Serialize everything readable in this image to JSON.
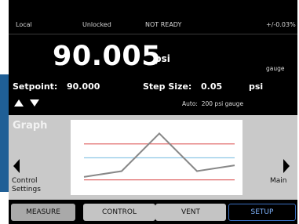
{
  "status": {
    "mode": "Local",
    "lock": "Unlocked",
    "ready": "NOT READY",
    "accuracy": "+/-0.03%"
  },
  "reading": {
    "value": "90.005",
    "unit": "psi",
    "gauge_label": "gauge"
  },
  "setpoint": {
    "label": "Setpoint:",
    "value": "90.000"
  },
  "step": {
    "label": "Step Size:",
    "value": "0.05",
    "unit": "psi"
  },
  "auto": {
    "label": "Auto:",
    "value": "200 psi gauge"
  },
  "graph": {
    "title": "Graph",
    "left_nav": [
      "Control",
      "Settings"
    ],
    "right_nav": "Main"
  },
  "tabs": [
    {
      "label": "MEASURE"
    },
    {
      "label": "CONTROL"
    },
    {
      "label": "VENT"
    },
    {
      "label": "SETUP"
    }
  ],
  "chart_data": {
    "type": "line",
    "x": [
      0,
      1,
      2,
      3,
      4
    ],
    "series": [
      {
        "values": [
          0.15,
          0.25,
          0.9,
          0.25,
          0.35
        ]
      }
    ],
    "reference_lines": [
      0.72,
      0.48,
      0.1
    ],
    "colors": {
      "series": "#888888",
      "red": "#e06a6a",
      "blue": "#8ec7e6"
    }
  }
}
